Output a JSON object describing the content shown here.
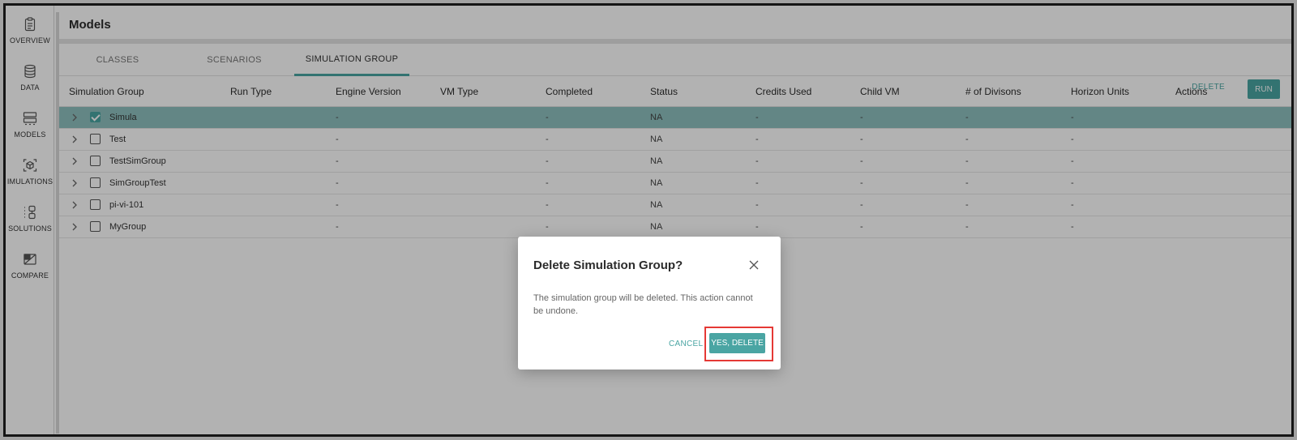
{
  "sidebar": {
    "items": [
      {
        "label": "OVERVIEW",
        "icon": "clipboard-icon"
      },
      {
        "label": "DATA",
        "icon": "database-icon"
      },
      {
        "label": "MODELS",
        "icon": "models-icon"
      },
      {
        "label": "IMULATIONS",
        "icon": "cube-icon"
      },
      {
        "label": "SOLUTIONS",
        "icon": "solutions-icon"
      },
      {
        "label": "COMPARE",
        "icon": "compare-icon"
      }
    ]
  },
  "header": {
    "title": "Models"
  },
  "tabs": [
    {
      "label": "CLASSES",
      "active": false
    },
    {
      "label": "SCENARIOS",
      "active": false
    },
    {
      "label": "SIMULATION GROUP",
      "active": true
    }
  ],
  "toolbar": {
    "delete_label": "DELETE",
    "run_label": "RUN"
  },
  "table": {
    "columns": [
      "Simulation Group",
      "Run Type",
      "Engine Version",
      "VM Type",
      "Completed",
      "Status",
      "Credits Used",
      "Child VM",
      "# of Divisons",
      "Horizon Units",
      "Actions"
    ],
    "rows": [
      {
        "name": "Simula",
        "checked": true,
        "engine": "-",
        "completed": "-",
        "status": "NA",
        "credits": "-",
        "child_vm": "-",
        "divisions": "-",
        "horizon": "-"
      },
      {
        "name": "Test",
        "checked": false,
        "engine": "-",
        "completed": "-",
        "status": "NA",
        "credits": "-",
        "child_vm": "-",
        "divisions": "-",
        "horizon": "-"
      },
      {
        "name": "TestSimGroup",
        "checked": false,
        "engine": "-",
        "completed": "-",
        "status": "NA",
        "credits": "-",
        "child_vm": "-",
        "divisions": "-",
        "horizon": "-"
      },
      {
        "name": "SimGroupTest",
        "checked": false,
        "engine": "-",
        "completed": "-",
        "status": "NA",
        "credits": "-",
        "child_vm": "-",
        "divisions": "-",
        "horizon": "-"
      },
      {
        "name": "pi-vi-101",
        "checked": false,
        "engine": "-",
        "completed": "-",
        "status": "NA",
        "credits": "-",
        "child_vm": "-",
        "divisions": "-",
        "horizon": "-"
      },
      {
        "name": "MyGroup",
        "checked": false,
        "engine": "-",
        "completed": "-",
        "status": "NA",
        "credits": "-",
        "child_vm": "-",
        "divisions": "-",
        "horizon": "-"
      }
    ]
  },
  "dialog": {
    "title": "Delete Simulation Group?",
    "message": "The simulation group will be deleted. This action cannot be undone.",
    "cancel_label": "CANCEL",
    "confirm_label": "YES, DELETE"
  },
  "colors": {
    "accent": "#4aa5a3",
    "highlight": "#e53935",
    "selected_row": "#8fc0bf"
  }
}
